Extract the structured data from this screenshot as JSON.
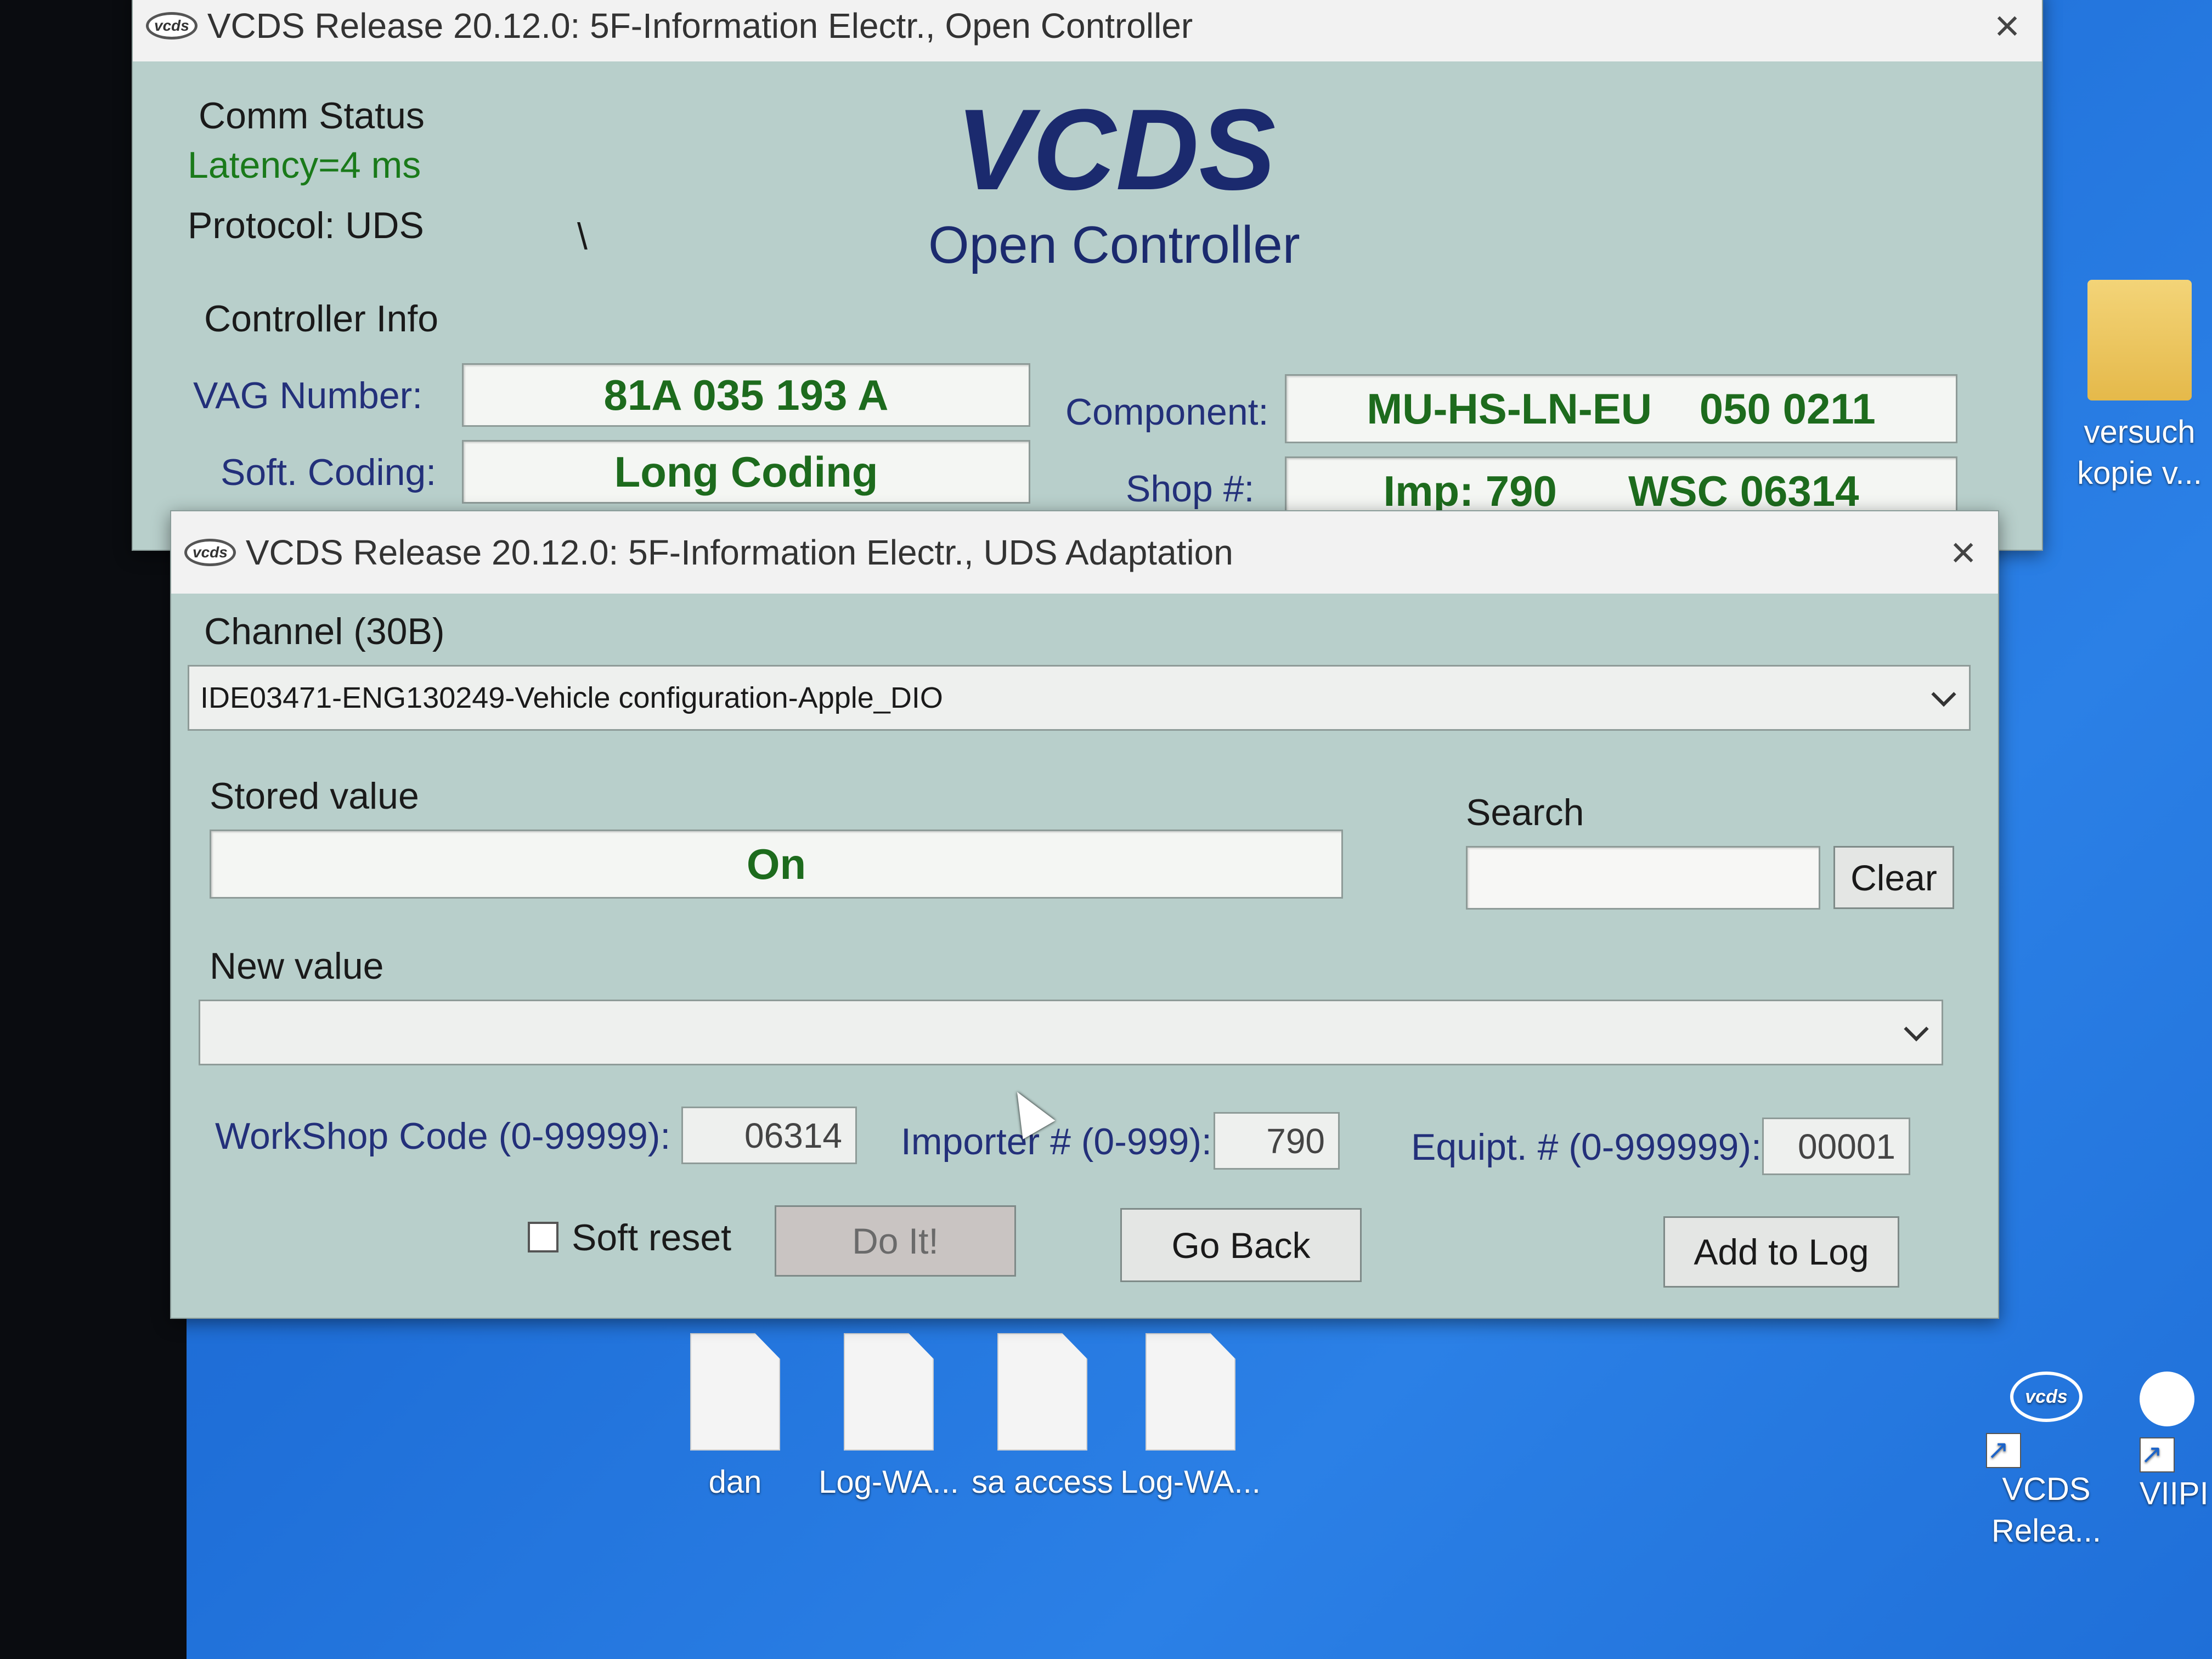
{
  "main_window": {
    "title": "VCDS Release 20.12.0: 5F-Information Electr.,  Open Controller",
    "comm_status_label": "Comm Status",
    "latency": "Latency=4 ms",
    "protocol": "Protocol: UDS",
    "spinner": "\\",
    "brand": "VCDS",
    "subtitle": "Open Controller",
    "controller_info_label": "Controller Info",
    "vag_number_label": "VAG Number:",
    "vag_number": "81A 035 193 A",
    "component_label": "Component:",
    "component": "MU-HS-LN-EU    050 0211",
    "soft_coding_label": "Soft. Coding:",
    "soft_coding": "Long Coding",
    "shop_label": "Shop #:",
    "shop": "Imp: 790      WSC 06314"
  },
  "adaptation_window": {
    "title": "VCDS Release 20.12.0: 5F-Information Electr.,  UDS Adaptation",
    "channel_label": "Channel (30B)",
    "channel_value": "IDE03471-ENG130249-Vehicle configuration-Apple_DIO",
    "stored_value_label": "Stored value",
    "stored_value": "On",
    "search_label": "Search",
    "search_value": "",
    "clear_label": "Clear",
    "new_value_label": "New value",
    "new_value": "",
    "workshop_label": "WorkShop Code (0-99999):",
    "workshop_value": "06314",
    "importer_label": "Importer # (0-999):",
    "importer_value": "790",
    "equipt_label": "Equipt. # (0-999999):",
    "equipt_value": "00001",
    "soft_reset_label": "Soft reset",
    "soft_reset_checked": false,
    "do_it_label": "Do It!",
    "go_back_label": "Go Back",
    "add_to_log_label": "Add to Log"
  },
  "desktop": {
    "icons": [
      {
        "label": "dan"
      },
      {
        "label": "Log-WA..."
      },
      {
        "label": "sa access"
      },
      {
        "label": "Log-WA..."
      }
    ],
    "folder": {
      "line1": "versuch",
      "line2": "kopie v..."
    },
    "vcds_shortcut": {
      "line1": "VCDS",
      "line2": "Relea..."
    },
    "other_shortcut": {
      "line1": "VIIPI"
    }
  },
  "icons": {
    "close": "×",
    "logo": "vcds"
  }
}
